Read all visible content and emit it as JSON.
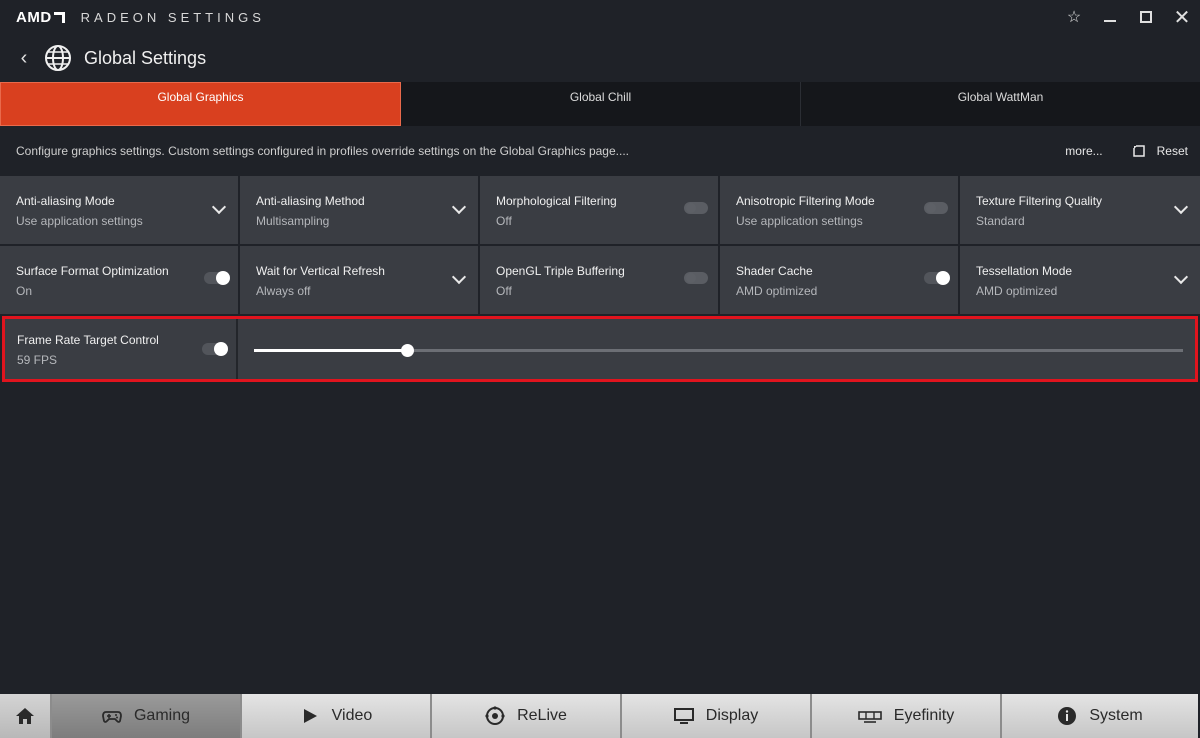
{
  "app": {
    "brand": "AMD",
    "title": "RADEON SETTINGS"
  },
  "window": {
    "favorite_icon": "star-icon",
    "minimize_icon": "minimize-icon",
    "maximize_icon": "maximize-icon",
    "close_icon": "close-icon",
    "close_glyph": "✕",
    "star_glyph": "☆"
  },
  "header": {
    "back_glyph": "‹",
    "title": "Global Settings"
  },
  "tabs": [
    {
      "label": "Global Graphics",
      "active": true
    },
    {
      "label": "Global Chill",
      "active": false
    },
    {
      "label": "Global WattMan",
      "active": false
    }
  ],
  "info": {
    "text": "Configure graphics settings. Custom settings configured in profiles override settings on the Global Graphics page....",
    "more_label": "more...",
    "reset_label": "Reset"
  },
  "settings": [
    [
      {
        "title": "Anti-aliasing Mode",
        "value": "Use application settings",
        "control": "dropdown"
      },
      {
        "title": "Anti-aliasing Method",
        "value": "Multisampling",
        "control": "dropdown"
      },
      {
        "title": "Morphological Filtering",
        "value": "Off",
        "control": "toggle",
        "on": false
      },
      {
        "title": "Anisotropic Filtering Mode",
        "value": "Use application settings",
        "control": "toggle",
        "on": false
      },
      {
        "title": "Texture Filtering Quality",
        "value": "Standard",
        "control": "dropdown"
      }
    ],
    [
      {
        "title": "Surface Format Optimization",
        "value": "On",
        "control": "toggle",
        "on": true
      },
      {
        "title": "Wait for Vertical Refresh",
        "value": "Always off",
        "control": "dropdown"
      },
      {
        "title": "OpenGL Triple Buffering",
        "value": "Off",
        "control": "toggle",
        "on": false
      },
      {
        "title": "Shader Cache",
        "value": "AMD optimized",
        "control": "toggle",
        "on": true
      },
      {
        "title": "Tessellation Mode",
        "value": "AMD optimized",
        "control": "dropdown"
      }
    ]
  ],
  "frame_rate": {
    "title": "Frame Rate Target Control",
    "value": "59 FPS",
    "enabled": true,
    "slider_fraction": 0.165
  },
  "colors": {
    "accent": "#d9401f",
    "highlight_border": "#e0141e",
    "panel": "#3a3d43",
    "background": "#1f2228"
  },
  "bottom_nav": [
    {
      "label": "",
      "icon": "home-icon",
      "active": false
    },
    {
      "label": "Gaming",
      "icon": "gamepad-icon",
      "active": true
    },
    {
      "label": "Video",
      "icon": "play-icon",
      "active": false
    },
    {
      "label": "ReLive",
      "icon": "relive-icon",
      "active": false
    },
    {
      "label": "Display",
      "icon": "monitor-icon",
      "active": false
    },
    {
      "label": "Eyefinity",
      "icon": "eyefinity-icon",
      "active": false
    },
    {
      "label": "System",
      "icon": "info-icon",
      "active": false
    }
  ]
}
